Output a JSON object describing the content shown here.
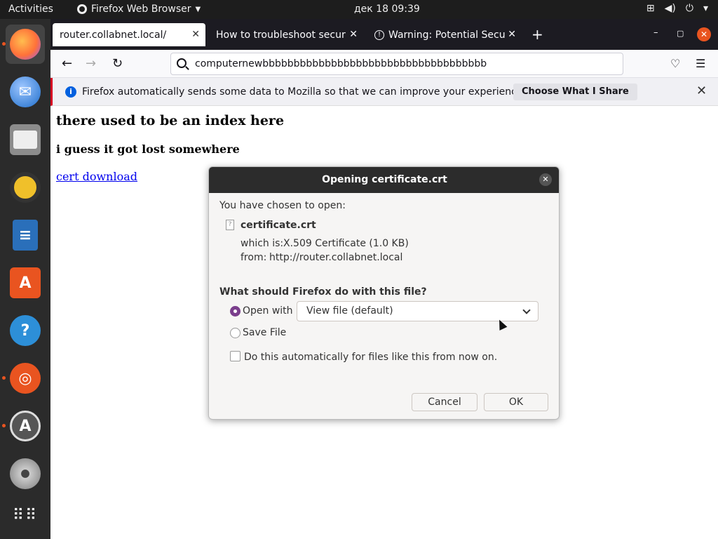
{
  "topbar": {
    "activities": "Activities",
    "app_name": "Firefox Web Browser",
    "clock": "дек 18  09:39",
    "status_icons": [
      "network-icon",
      "volume-icon",
      "power-icon",
      "chevron-down-icon"
    ]
  },
  "dock": {
    "items": [
      "firefox",
      "thunderbird",
      "files",
      "rhythmbox",
      "libreoffice-writer",
      "software",
      "help",
      "ubuntu",
      "software-updater",
      "dvd",
      "show-apps"
    ]
  },
  "browser": {
    "tabs": [
      {
        "label": "router.collabnet.local/",
        "active": true
      },
      {
        "label": "How to troubleshoot securit",
        "active": false
      },
      {
        "label": "Warning: Potential Secur",
        "active": false
      }
    ],
    "url": "computernewbbbbbbbbbbbbbbbbbbbbbbbbbbbbbbbbbbbb",
    "notice": {
      "text": "Firefox automatically sends some data to Mozilla so that we can improve your experience.",
      "button": "Choose What I Share"
    }
  },
  "page": {
    "heading": "there used to be an index here",
    "subheading": "i guess it got lost somewhere",
    "link": "cert download"
  },
  "dialog": {
    "title": "Opening certificate.crt",
    "chosen_label": "You have chosen to open:",
    "file_name": "certificate.crt",
    "which_is_label": "which is:",
    "which_is_value": "X.509 Certificate (1.0 KB)",
    "from_label": "from:",
    "from_value": "http://router.collabnet.local",
    "question": "What should Firefox do with this file?",
    "open_with_label": "Open with",
    "open_with_value": "View file (default)",
    "save_file_label": "Save File",
    "auto_label": "Do this automatically for files like this from now on.",
    "cancel": "Cancel",
    "ok": "OK"
  }
}
